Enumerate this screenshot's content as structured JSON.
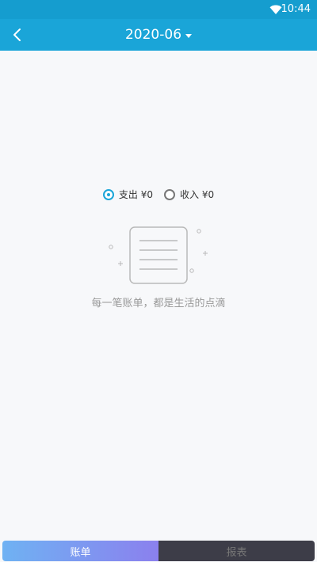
{
  "status_bar": {
    "time": "10:44",
    "wifi_icon": "wifi-icon"
  },
  "header": {
    "back_icon": "chevron-left-icon",
    "month": "2020-06",
    "dropdown_icon": "caret-down-icon",
    "color": "#1aa5d8"
  },
  "toggle": {
    "expense_label": "支出 ¥0",
    "income_label": "收入 ¥0",
    "selected": "expense"
  },
  "empty_state": {
    "icon": "empty-ledger-icon",
    "message": "每一笔账单，都是生活的点滴"
  },
  "tabs": [
    {
      "label": "账单",
      "active": true
    },
    {
      "label": "报表",
      "active": false
    }
  ]
}
